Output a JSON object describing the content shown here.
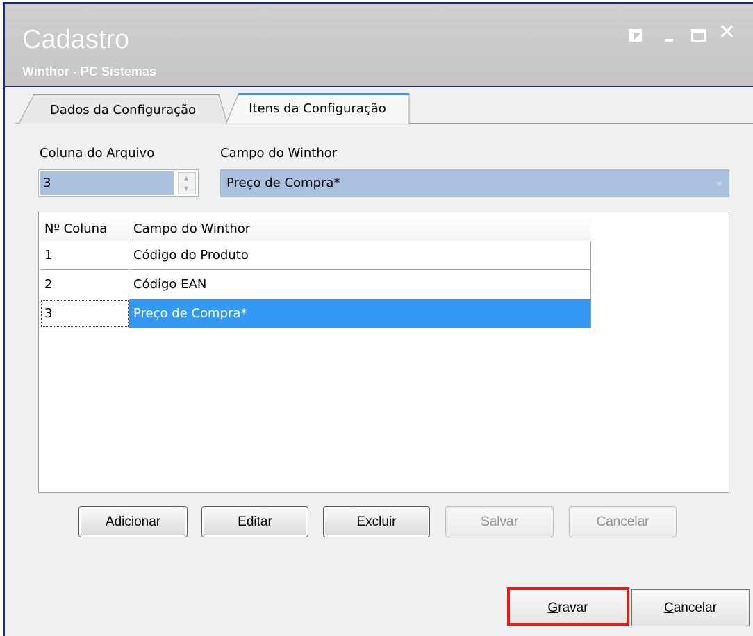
{
  "window": {
    "title": "Cadastro",
    "subtitle": "Winthor - PC Sistemas",
    "controls": [
      "help-icon",
      "minimize-icon",
      "maximize-icon",
      "close-icon"
    ],
    "close_glyph": "✕"
  },
  "tabs": [
    {
      "label": "Dados da Configuração",
      "active": false
    },
    {
      "label": "Itens da Configuração",
      "active": true
    }
  ],
  "form": {
    "coluna_label": "Coluna do Arquivo",
    "coluna_value": "3",
    "campo_label": "Campo do Winthor",
    "campo_value": "Preço de Compra*"
  },
  "grid": {
    "columns": [
      "Nº Coluna",
      "Campo do Winthor"
    ],
    "rows": [
      {
        "col": "1",
        "campo": "Código do Produto"
      },
      {
        "col": "2",
        "campo": "Código EAN"
      },
      {
        "col": "3",
        "campo": "Preço de Compra*",
        "selected": true
      }
    ]
  },
  "actions": {
    "adicionar": "Adicionar",
    "editar": "Editar",
    "excluir": "Excluir",
    "salvar": "Salvar",
    "cancelar": "Cancelar"
  },
  "footer": {
    "gravar_first": "G",
    "gravar_rest": "ravar",
    "cancelar_first": "C",
    "cancelar_rest": "ancelar"
  },
  "colors": {
    "accent_selection": "#3399f5",
    "highlight_box": "#e8191b",
    "window_border": "#1e2a78",
    "input_fill": "#a9c1de"
  }
}
